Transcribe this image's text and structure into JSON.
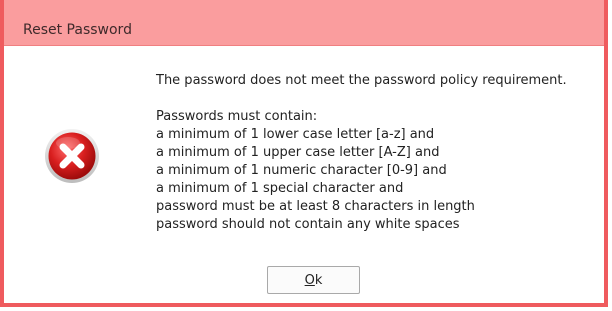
{
  "window": {
    "title": "Reset Password"
  },
  "dialog": {
    "icon": "error-icon",
    "headline": "The password does not meet the password policy requirement.",
    "requirements_intro": "Passwords must contain:",
    "requirements": [
      "a minimum of 1 lower case letter [a-z] and",
      "a minimum of 1 upper case letter [A-Z] and",
      "a minimum of 1 numeric character [0-9] and",
      "a minimum of 1 special character and",
      "password must be at least 8 characters in length",
      "password should not contain any white spaces"
    ]
  },
  "buttons": {
    "ok_mnemonic": "O",
    "ok_rest": "k"
  },
  "colors": {
    "frame": "#ef5b5e",
    "titlebar": "#fa9d9e",
    "error_red": "#d42a2a"
  }
}
